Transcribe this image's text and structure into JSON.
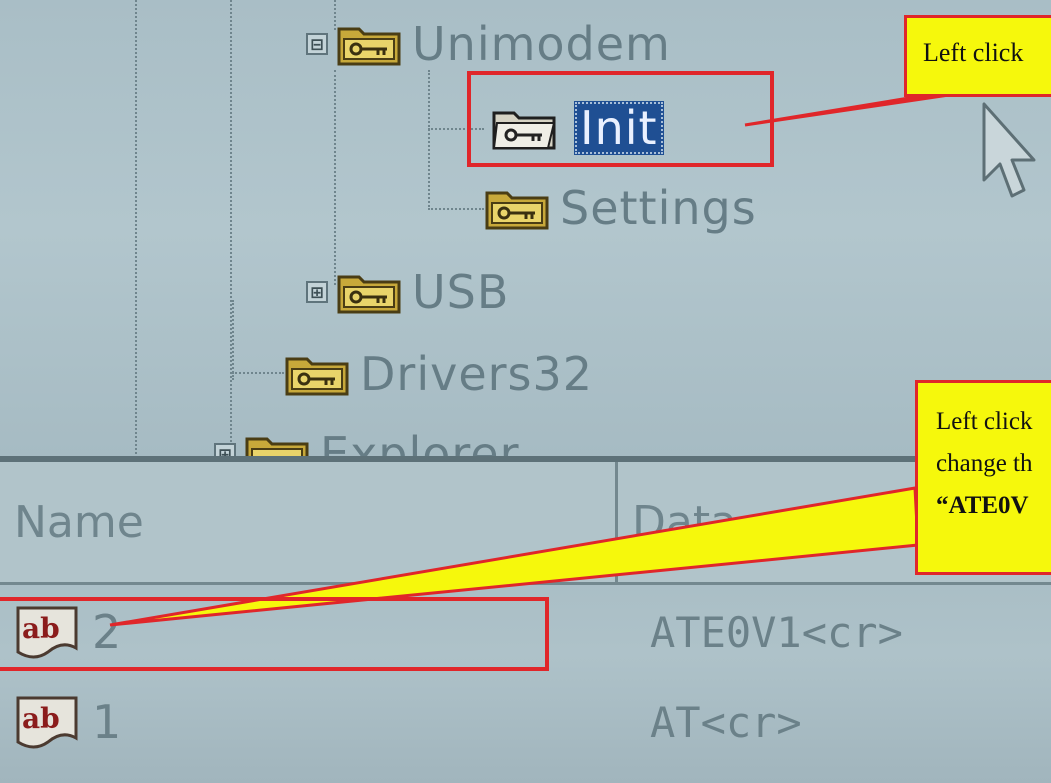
{
  "tree": {
    "nodes": [
      {
        "label": "Unimodem",
        "expander": "⊟"
      },
      {
        "label": "Init",
        "selected": true
      },
      {
        "label": "Settings"
      },
      {
        "label": "USB",
        "expander": "⊞"
      },
      {
        "label": "Drivers32"
      },
      {
        "label": "Explorer",
        "expander": "⊞"
      }
    ],
    "icon": "key-folder-icon"
  },
  "list": {
    "columns": [
      "Name",
      "Data"
    ],
    "rows": [
      {
        "icon": "string-value-icon",
        "icon_text": "ab",
        "name": "2",
        "data": "ATE0V1<cr>"
      },
      {
        "icon": "string-value-icon",
        "icon_text": "ab",
        "name": "1",
        "data": "AT<cr>"
      }
    ]
  },
  "annotations": {
    "callout_top": "Left click",
    "callout_bottom_line1": "Left click",
    "callout_bottom_line2": "change th",
    "callout_bottom_line3": "“ATE0V"
  },
  "colors": {
    "callout_fill": "#f6f80c",
    "callout_border": "#e0262a",
    "selection": "#1f4f93"
  }
}
